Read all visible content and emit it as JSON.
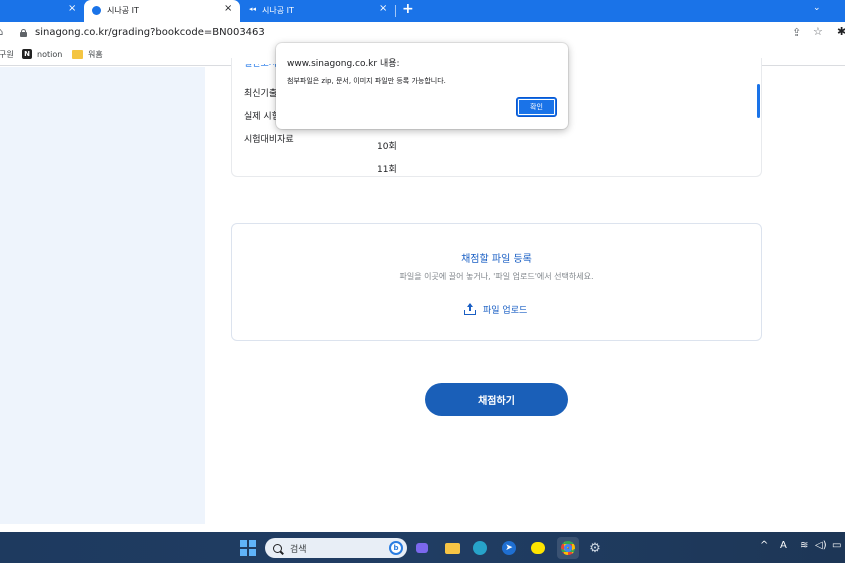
{
  "browser": {
    "tabs": [
      {
        "title": "",
        "close": "×"
      },
      {
        "title": "시나공 IT",
        "close": "×"
      },
      {
        "title": "시나공 IT",
        "close": "×"
      }
    ],
    "new_tab": "+",
    "dropdown": "⌄",
    "url": "sinagong.co.kr/grading?bookcode=BN003463",
    "bookmarks": [
      "구원",
      "notion",
      "워홈"
    ]
  },
  "page": {
    "menu": {
      "clipped_item": "일반도서",
      "items": [
        "최신기출",
        "실제 시험",
        "시험대비자료"
      ],
      "sub_items": [
        "10회",
        "11회"
      ]
    },
    "upload": {
      "title": "채점할 파일 등록",
      "description": "파일을 이곳에 끌어 놓거나, '파일 업로드'에서 선택하세요.",
      "button_label": "파일 업로드"
    },
    "grade_button": "채점하기"
  },
  "dialog": {
    "title": "www.sinagong.co.kr 내용:",
    "message": "첨부파일은 zip, 문서, 이미지 파일만 등록 가능합니다.",
    "ok_label": "확인"
  },
  "taskbar": {
    "search_label": "검색",
    "tray_language": "A"
  },
  "colors": {
    "accent": "#1a73e8",
    "primary_button": "#1a5fb8",
    "left_panel": "#eef4fc"
  }
}
